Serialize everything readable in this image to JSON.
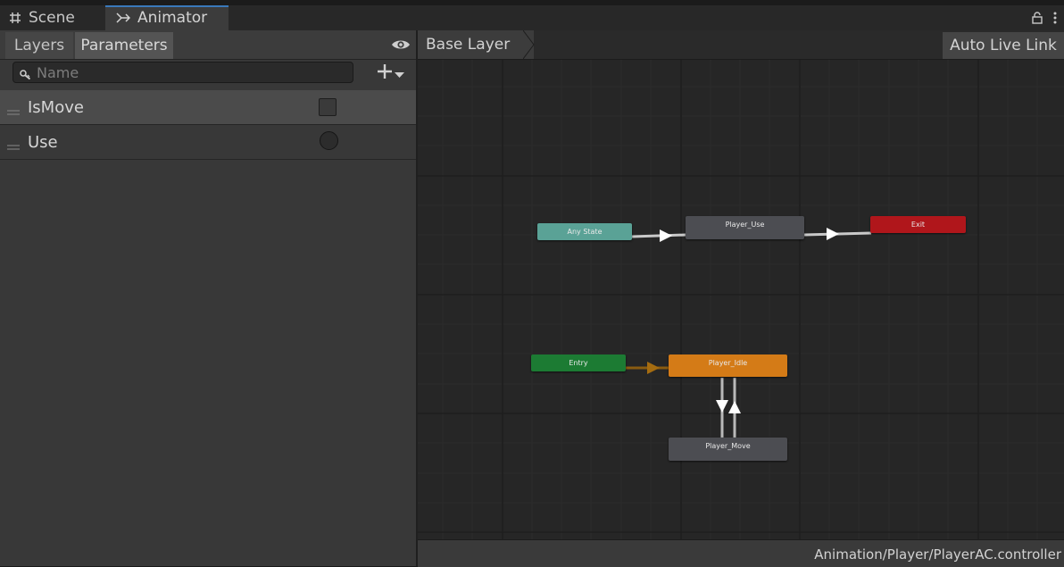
{
  "tabs": {
    "scene": "Scene",
    "animator": "Animator"
  },
  "left_panel": {
    "tabs": {
      "layers": "Layers",
      "parameters": "Parameters"
    },
    "search": {
      "placeholder": "Name",
      "value": ""
    },
    "parameters": [
      {
        "name": "IsMove",
        "type": "bool",
        "selected": true
      },
      {
        "name": "Use",
        "type": "trigger",
        "selected": false
      }
    ]
  },
  "graph": {
    "breadcrumb": "Base Layer",
    "auto_live_link": "Auto Live Link",
    "nodes": {
      "any_state": "Any State",
      "player_use": "Player_Use",
      "exit": "Exit",
      "entry": "Entry",
      "player_idle": "Player_Idle",
      "player_move": "Player_Move"
    },
    "colors": {
      "any_state": "#5aa296",
      "state": "#4c4d52",
      "exit": "#b0161b",
      "entry": "#1c7b33",
      "default_state": "#d47b17",
      "default_transition": "#8a5b10"
    }
  },
  "footer": {
    "path": "Animation/Player/PlayerAC.controller"
  }
}
